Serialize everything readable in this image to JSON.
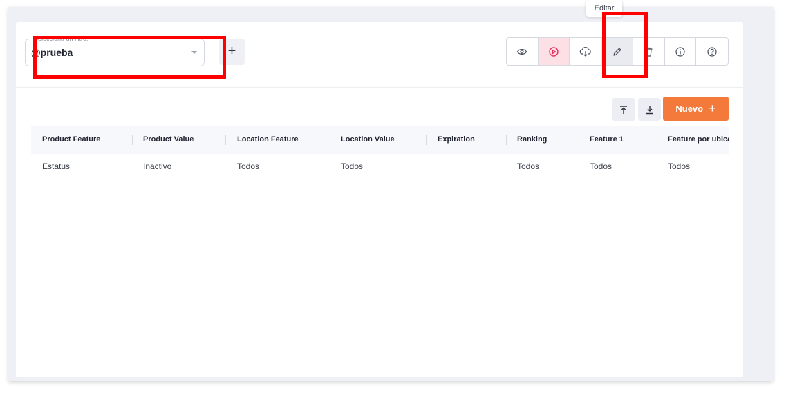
{
  "filter": {
    "label": "Selecciona un filtro:",
    "value": "@prueba"
  },
  "add_filter_label": "+",
  "toolbar": {
    "buttons": [
      {
        "icon": "eye-icon"
      },
      {
        "icon": "play-circle-icon",
        "state": "active"
      },
      {
        "icon": "cloud-download-icon"
      },
      {
        "icon": "pencil-icon",
        "state": "hover"
      },
      {
        "icon": "trash-icon"
      },
      {
        "icon": "info-icon"
      },
      {
        "icon": "help-icon"
      }
    ],
    "tooltip": "Editar"
  },
  "actions": {
    "upload_icon": "upload-icon",
    "download_icon": "download-icon",
    "nuevo_label": "Nuevo",
    "nuevo_plus": "+"
  },
  "table": {
    "columns": [
      "Product Feature",
      "Product Value",
      "Location Feature",
      "Location Value",
      "Expiration",
      "Ranking",
      "Feature 1",
      "Feature por ubica"
    ],
    "rows": [
      [
        "Estatus",
        "Inactivo",
        "Todos",
        "Todos",
        "",
        "Todos",
        "Todos",
        "Todos"
      ]
    ]
  },
  "colors": {
    "accent_orange": "#f37a3b",
    "active_pink": "#fde0e5",
    "active_icon": "#e8315b",
    "highlight_red": "#ff0000"
  }
}
